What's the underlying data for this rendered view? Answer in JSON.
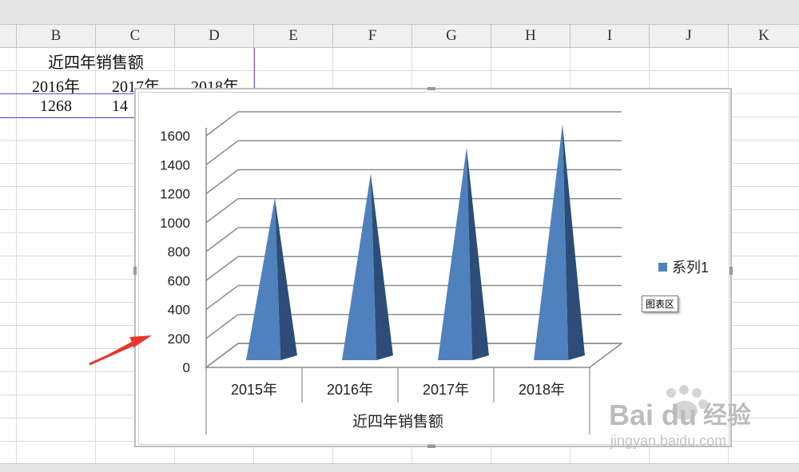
{
  "spreadsheet": {
    "columns": [
      "B",
      "C",
      "D",
      "E",
      "F",
      "G",
      "H",
      "I",
      "J",
      "K"
    ],
    "title_cell": "近四年销售额",
    "year_cells": [
      "2016年",
      "2017年",
      "2018年"
    ],
    "value_cells": [
      "1268",
      "14"
    ]
  },
  "tooltip": "图表区",
  "watermark": {
    "brand": "Bai",
    "brand2": "du",
    "text": "经验",
    "url": "jingyan.baidu.com"
  },
  "chart_data": {
    "type": "bar",
    "style": "3d-cone",
    "title": "",
    "categories": [
      "2015年",
      "2016年",
      "2017年",
      "2018年"
    ],
    "category_group_label": "近四年销售额",
    "series": [
      {
        "name": "系列1",
        "values": [
          1120,
          1290,
          1470,
          1630
        ],
        "color": "#4f81bd"
      }
    ],
    "yticks": [
      0,
      200,
      400,
      600,
      800,
      1000,
      1200,
      1400,
      1600
    ],
    "ylim": [
      0,
      1600
    ],
    "grid": true,
    "legend": "right"
  }
}
